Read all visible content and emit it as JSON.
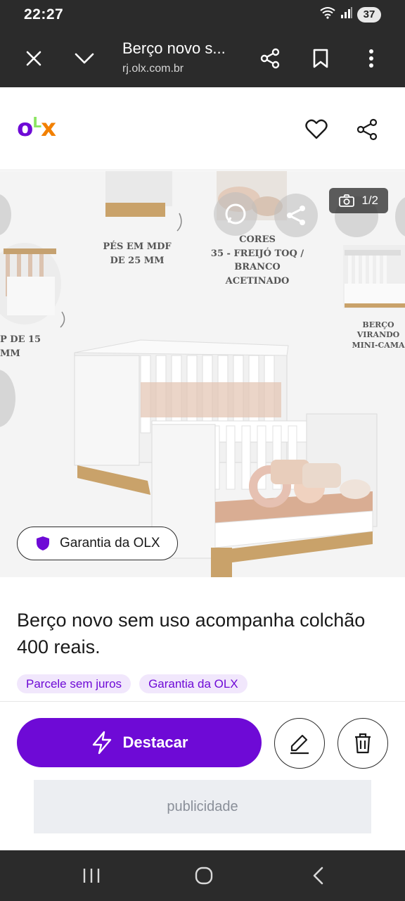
{
  "status_bar": {
    "time": "22:27",
    "battery": "37"
  },
  "browser": {
    "title": "Berço novo s...",
    "url": "rj.olx.com.br",
    "icons": [
      "close-icon",
      "chevron-down-icon",
      "share-icon",
      "bookmark-icon",
      "more-vert-icon"
    ]
  },
  "site_header": {
    "logo": {
      "o": "o",
      "l": "L",
      "x": "x"
    },
    "icons": [
      "heart-icon",
      "share-icon"
    ],
    "colors": {
      "o": "#6e0ad6",
      "l": "#8ce563",
      "x": "#f28000"
    }
  },
  "gallery": {
    "counter": "1/2",
    "annotations": {
      "feet": [
        "PÉS EM MDF",
        "DE 25 MM"
      ],
      "colors": [
        "CORES",
        "35 - FREIJÓ TOQ / BRANCO",
        "ACETINADO"
      ],
      "side": [
        "P DE 15 MM"
      ],
      "convert": [
        "BERÇO VIRANDO",
        "MINI-CAMA"
      ]
    },
    "warranty_pill": "Garantia da OLX"
  },
  "listing": {
    "title": "Berço novo sem uso acompanha colchão 400 reais.",
    "tags": [
      "Parcele sem juros",
      "Garantia da OLX"
    ]
  },
  "actions": {
    "feature_label": "Destacar",
    "accent": "#6e0ad6"
  },
  "ad": {
    "label": "publicidade"
  }
}
